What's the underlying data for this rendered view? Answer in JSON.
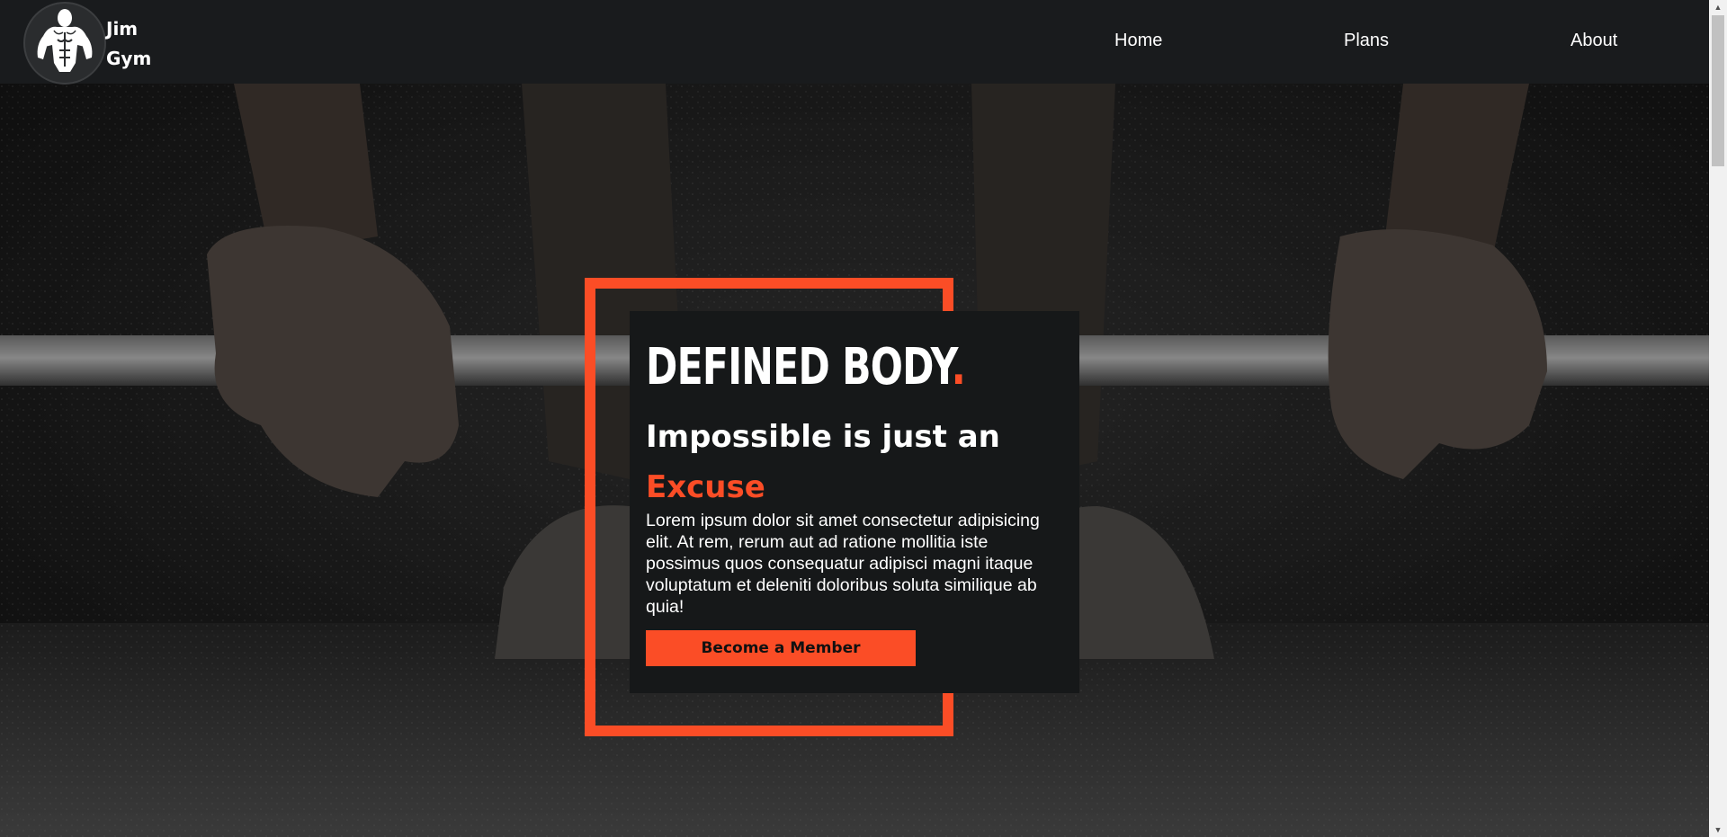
{
  "brand": {
    "logo_icon": "bodybuilder-logo-icon",
    "name_line1": "Jim",
    "name_line2": "Gym"
  },
  "nav": {
    "items": [
      {
        "label": "Home"
      },
      {
        "label": "Plans"
      },
      {
        "label": "About"
      }
    ]
  },
  "hero": {
    "headline": "DEFINED BODY",
    "headline_dot": ".",
    "tagline_line1": "Impossible is just an",
    "tagline_accent": "Excuse",
    "description": "Lorem ipsum dolor sit amet consectetur adipisicing elit. At rem, rerum aut ad ratione mollitia iste possimus quos consequatur adipisci magni itaque voluptatum et deleniti doloribus soluta similique ab quia!",
    "cta_label": "Become a Member",
    "background_image": "barbell-deadlift-photo"
  },
  "colors": {
    "accent": "#fb4d26",
    "nav_bg": "#191b1d",
    "card_bg": "#161819",
    "text": "#ffffff"
  },
  "scrollbar": {
    "up_icon": "scroll-up-arrow-icon",
    "down_icon": "scroll-down-arrow-icon"
  }
}
